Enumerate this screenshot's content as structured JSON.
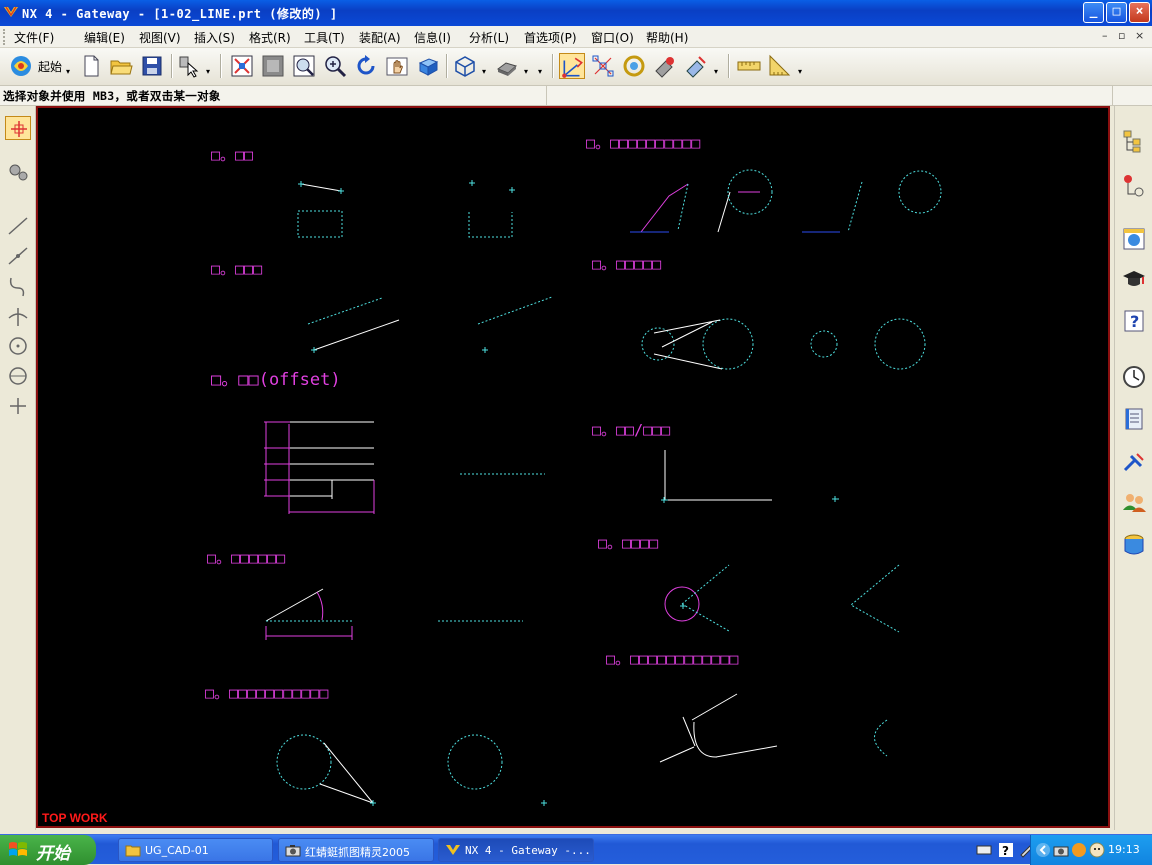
{
  "window": {
    "title": "NX 4 - Gateway - [1-02_LINE.prt  (修改的) ]",
    "controls": [
      "_",
      "□",
      "×"
    ]
  },
  "menu": {
    "items": [
      "文件(F)",
      "编辑(E)",
      "视图(V)",
      "插入(S)",
      "格式(R)",
      "工具(T)",
      "装配(A)",
      "信息(I)",
      "分析(L)",
      "首选项(P)",
      "窗口(O)",
      "帮助(H)"
    ],
    "child_controls": [
      "–",
      "▫",
      "×"
    ]
  },
  "toolbar": {
    "start_label": "起始",
    "icons": [
      "nx-start-icon",
      "new-file-icon",
      "open-folder-icon",
      "save-icon",
      "select-filter-icon",
      "fit-view-icon",
      "zoom-window-icon",
      "zoom-in-out-icon",
      "rotate-icon",
      "pan-icon",
      "view-orient-icon",
      "render-style-icon",
      "shaded-icon",
      "wcs-icon",
      "snap-points-icon",
      "layer-icon",
      "point-icon",
      "measure-icon",
      "ruler-icon",
      "triangle-icon"
    ]
  },
  "cue_line": "选择对象并使用 MB3，或者双击某一对象",
  "viewport": {
    "watermark": "TOP WORK",
    "section_labels": [
      "□。□□",
      "□。□□□",
      "□。□□(offset)",
      "□。□□□□□□",
      "□。□□□□□□□□□□□",
      "□。□□□□□□□□□□",
      "□。□□□□□",
      "□。□□/□□□",
      "□。□□□□",
      "□。□□□□□□□□□□□□"
    ]
  },
  "taskbar": {
    "start_label": "开始",
    "tasks": [
      "UG_CAD-01",
      "红蜻蜓抓图精灵2005",
      "NX 4 - Gateway -..."
    ],
    "clock": "19:13"
  }
}
